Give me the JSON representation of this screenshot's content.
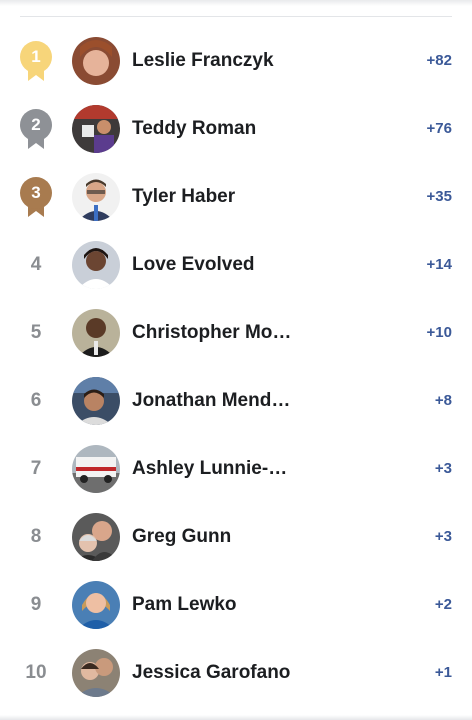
{
  "leaderboard": {
    "rows": [
      {
        "rank": "1",
        "name": "Leslie Franczyk",
        "score": "+82",
        "medal": "gold"
      },
      {
        "rank": "2",
        "name": "Teddy Roman",
        "score": "+76",
        "medal": "silver"
      },
      {
        "rank": "3",
        "name": "Tyler Haber",
        "score": "+35",
        "medal": "bronze"
      },
      {
        "rank": "4",
        "name": "Love Evolved",
        "score": "+14"
      },
      {
        "rank": "5",
        "name": "Christopher Mo…",
        "score": "+10"
      },
      {
        "rank": "6",
        "name": "Jonathan Mend…",
        "score": "+8"
      },
      {
        "rank": "7",
        "name": "Ashley Lunnie-R…",
        "score": "+3"
      },
      {
        "rank": "8",
        "name": "Greg Gunn",
        "score": "+3"
      },
      {
        "rank": "9",
        "name": "Pam Lewko",
        "score": "+2"
      },
      {
        "rank": "10",
        "name": "Jessica Garofano",
        "score": "+1"
      }
    ]
  },
  "colors": {
    "gold": "#f7d57a",
    "silver": "#8e9196",
    "bronze": "#a87b4f",
    "score": "#3b5998",
    "rank": "#8a8d91"
  }
}
